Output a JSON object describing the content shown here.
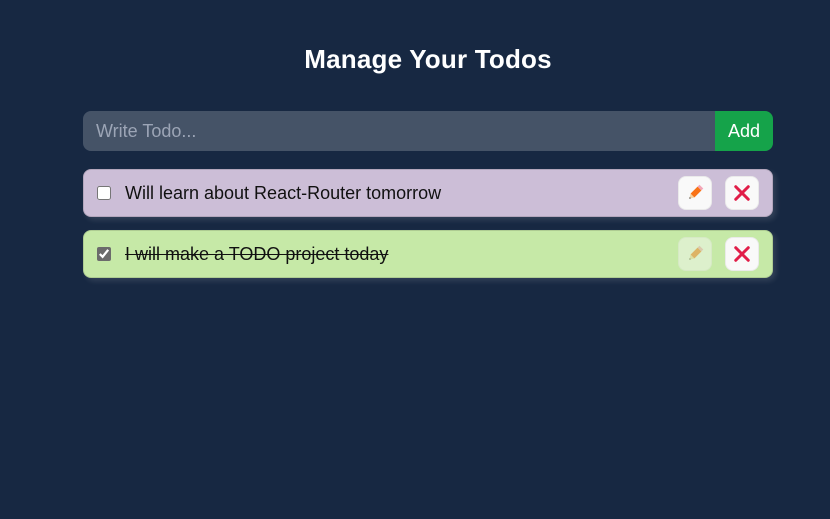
{
  "header": {
    "title": "Manage Your Todos"
  },
  "form": {
    "input_placeholder": "Write Todo...",
    "input_value": "",
    "add_label": "Add"
  },
  "colors": {
    "background": "#172842",
    "add_button": "#15a34a",
    "todo_pending": "#ccbed7",
    "todo_done": "#c6e9a7",
    "edit_icon": "#f97316",
    "delete_icon": "#e11d48"
  },
  "todos": [
    {
      "text": "Will learn about React-Router tomorrow",
      "completed": false,
      "edit_icon": "pencil-icon",
      "delete_icon": "close-icon"
    },
    {
      "text": "I will make a TODO project today",
      "completed": true,
      "edit_icon": "pencil-icon",
      "delete_icon": "close-icon"
    }
  ]
}
